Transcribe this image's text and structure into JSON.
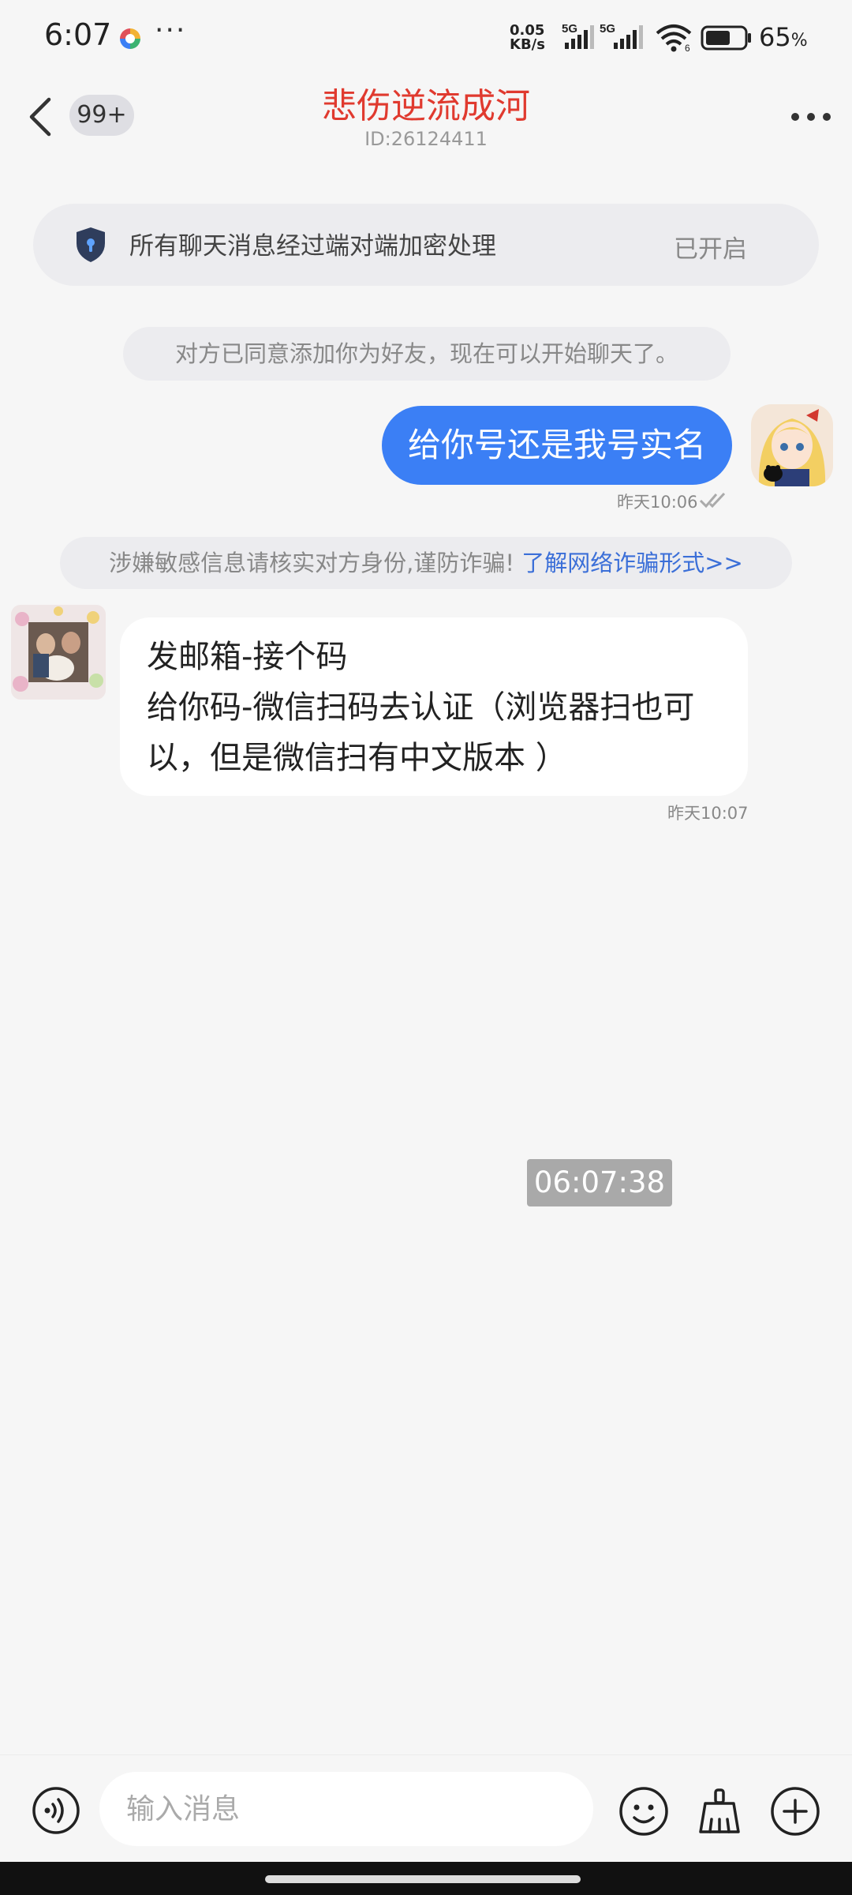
{
  "status_bar": {
    "time": "6:07",
    "more": "···",
    "net_speed_value": "0.05",
    "net_speed_unit": "KB/s",
    "sim1_label": "5G",
    "sim2_label": "5G",
    "wifi_label": "6",
    "battery_level": 0.65,
    "battery_text": "65",
    "battery_unit": "%"
  },
  "header": {
    "unread_badge": "99+",
    "title": "悲伤逆流成河",
    "id_text": "ID:26124411"
  },
  "encryption_banner": {
    "text": "所有聊天消息经过端对端加密处理",
    "status": "已开启"
  },
  "messages": {
    "friend_notice": "对方已同意添加你为好友，现在可以开始聊天了。",
    "outgoing": {
      "text": "给你号还是我号实名",
      "time": "昨天10:06"
    },
    "fraud_warning": {
      "text": "涉嫌敏感信息请核实对方身份,谨防诈骗! ",
      "link": "了解网络诈骗形式>>"
    },
    "incoming": {
      "line1": "发邮箱-接个码",
      "line2": "给你码-微信扫码去认证（浏览器扫也可以，但是微信扫有中文版本 ）",
      "time": "昨天10:07"
    }
  },
  "clock_overlay": "06:07:38",
  "input": {
    "placeholder": "输入消息"
  },
  "colors": {
    "accent_blue": "#3b7ff5",
    "title_red": "#e03a2f",
    "link_blue": "#3b6fd8",
    "background": "#f6f6f6"
  },
  "icons": {
    "back": "chevron-left-icon",
    "more": "more-horizontal-icon",
    "shield": "shield-lock-icon",
    "voice": "voice-icon",
    "emoji": "emoji-icon",
    "clean": "broom-icon",
    "plus": "plus-circle-icon"
  }
}
